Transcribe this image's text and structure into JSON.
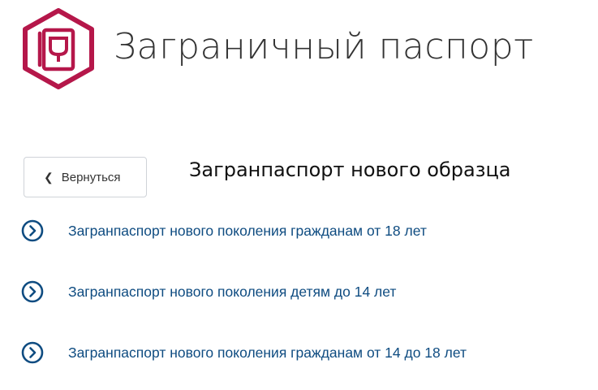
{
  "header": {
    "title": "Заграничный паспорт",
    "icon": "passport-icon",
    "brand_color": "#b5174a"
  },
  "back_button": {
    "label": "Вернуться",
    "icon": "chevron-left-icon"
  },
  "section": {
    "title": "Загранпаспорт нового образца"
  },
  "links": [
    {
      "label": "Загранпаспорт нового поколения гражданам от 18 лет",
      "icon": "chevron-right-circle-icon"
    },
    {
      "label": "Загранпаспорт нового поколения детям до 14 лет",
      "icon": "chevron-right-circle-icon"
    },
    {
      "label": "Загранпаспорт нового поколения гражданам от 14 до 18 лет",
      "icon": "chevron-right-circle-icon"
    }
  ],
  "colors": {
    "link": "#0f4c81",
    "text": "#333333"
  }
}
